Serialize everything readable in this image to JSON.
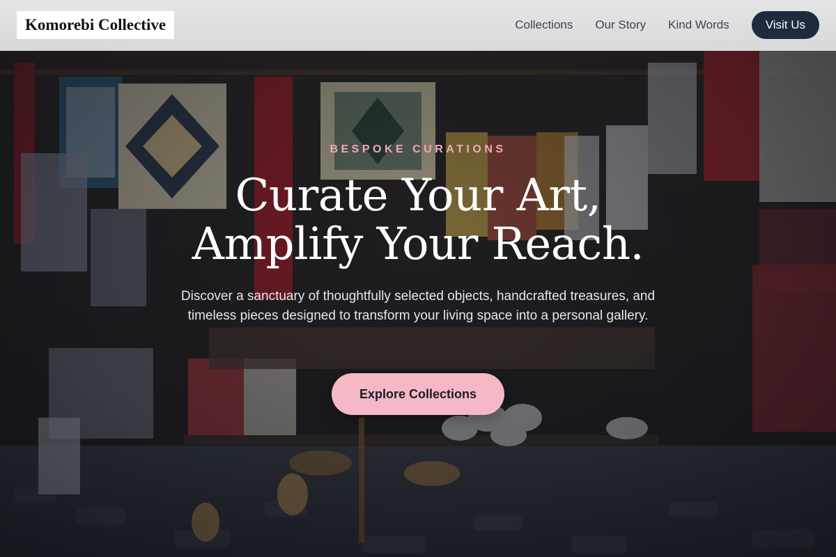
{
  "header": {
    "brand": "Komorebi Collective",
    "nav": [
      {
        "label": "Collections"
      },
      {
        "label": "Our Story"
      },
      {
        "label": "Kind Words"
      }
    ],
    "cta_label": "Visit Us"
  },
  "hero": {
    "eyebrow": "BESPOKE CURATIONS",
    "headline_line1": "Curate Your Art,",
    "headline_line2": "Amplify Your Reach.",
    "subtext": "Discover a sanctuary of thoughtfully selected objects, handcrafted treasures, and timeless pieces designed to transform your living space into a personal gallery.",
    "cta_label": "Explore Collections"
  },
  "colors": {
    "accent_pink": "#f6b7c7",
    "eyebrow_pink": "#f3a9bb",
    "nav_button_dark": "#1f2a3d"
  }
}
